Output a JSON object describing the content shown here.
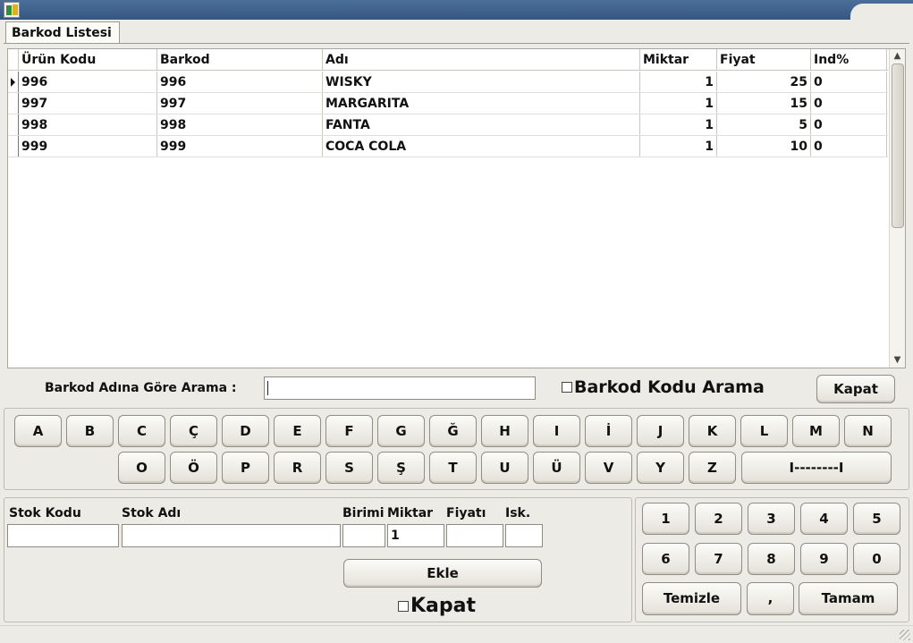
{
  "window": {
    "icon": "app-icon"
  },
  "tab": {
    "label": "Barkod Listesi"
  },
  "grid": {
    "columns": [
      "Ürün Kodu",
      "Barkod",
      "Adı",
      "Miktar",
      "Fiyat",
      "Ind%"
    ],
    "rows": [
      {
        "kod": "996",
        "barkod": "996",
        "adi": "WISKY",
        "miktar": "1",
        "fiyat": "25",
        "ind": "0"
      },
      {
        "kod": "997",
        "barkod": "997",
        "adi": "MARGARITA",
        "miktar": "1",
        "fiyat": "15",
        "ind": "0"
      },
      {
        "kod": "998",
        "barkod": "998",
        "adi": "FANTA",
        "miktar": "1",
        "fiyat": "5",
        "ind": "0"
      },
      {
        "kod": "999",
        "barkod": "999",
        "adi": "COCA COLA",
        "miktar": "1",
        "fiyat": "10",
        "ind": "0"
      }
    ]
  },
  "search": {
    "label": "Barkod Adına Göre Arama :",
    "value": "",
    "barcode_checkbox_label": "Barkod Kodu Arama",
    "close_label": "Kapat"
  },
  "keyboard": {
    "row1": [
      "A",
      "B",
      "C",
      "Ç",
      "D",
      "E",
      "F",
      "G",
      "Ğ",
      "H",
      "I",
      "İ",
      "J",
      "K",
      "L",
      "M",
      "N"
    ],
    "row2": [
      "O",
      "Ö",
      "P",
      "R",
      "S",
      "Ş",
      "T",
      "U",
      "Ü",
      "V",
      "Y",
      "Z"
    ],
    "space_label": "I--------I"
  },
  "stock": {
    "kodu_label": "Stok Kodu",
    "adi_label": "Stok Adı",
    "birimi_label": "Birimi",
    "miktar_label": "Miktar",
    "fiyati_label": "Fiyatı",
    "isk_label": "Isk.",
    "kodu_value": "",
    "adi_value": "",
    "birimi_value": "",
    "miktar_value": "1",
    "fiyati_value": "",
    "isk_value": "",
    "add_label": "Ekle",
    "close_checkbox_label": "Kapat"
  },
  "numpad": {
    "row1": [
      "1",
      "2",
      "3",
      "4",
      "5"
    ],
    "row2": [
      "6",
      "7",
      "8",
      "9",
      "0"
    ],
    "clear_label": "Temizle",
    "comma_label": ",",
    "ok_label": "Tamam"
  }
}
